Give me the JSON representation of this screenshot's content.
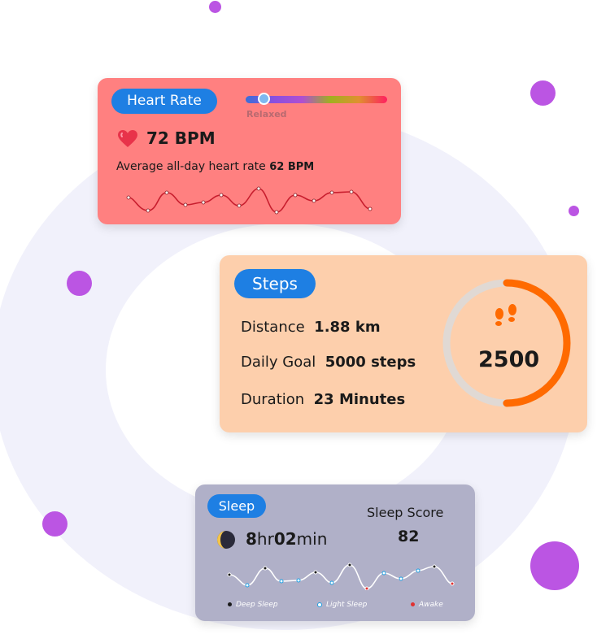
{
  "colors": {
    "accent": "#1e7fe3",
    "heart_card": "#ff8080",
    "steps_card": "#fdcfac",
    "sleep_card": "#b0b0c8",
    "decor_dot": "#bb55e3",
    "progress": "#ff6a00"
  },
  "heart": {
    "title": "Heart Rate",
    "icon": "heart-icon",
    "bpm": "72 BPM",
    "zone_label": "Relaxed",
    "zone_level": 0.12,
    "average_label": "Average all-day heart rate",
    "average_value": "62 BPM"
  },
  "steps": {
    "title": "Steps",
    "distance_label": "Distance",
    "distance_value": "1.88 km",
    "goal_label": "Daily Goal",
    "goal_value": "5000 steps",
    "duration_label": "Duration",
    "duration_value": "23 Minutes",
    "count": "2500",
    "progress": 0.5,
    "icon": "footprints-icon"
  },
  "sleep": {
    "title": "Sleep",
    "icon": "moon-icon",
    "duration_h": "8",
    "duration_h_unit": "hr",
    "duration_m": "02",
    "duration_m_unit": "min",
    "score_label": "Sleep Score",
    "score": "82",
    "legend": [
      {
        "label": "Deep Sleep",
        "color": "#1a1a1a"
      },
      {
        "label": "Light Sleep",
        "color": "#1e9fe3"
      },
      {
        "label": "Awake",
        "color": "#e03030"
      }
    ]
  }
}
